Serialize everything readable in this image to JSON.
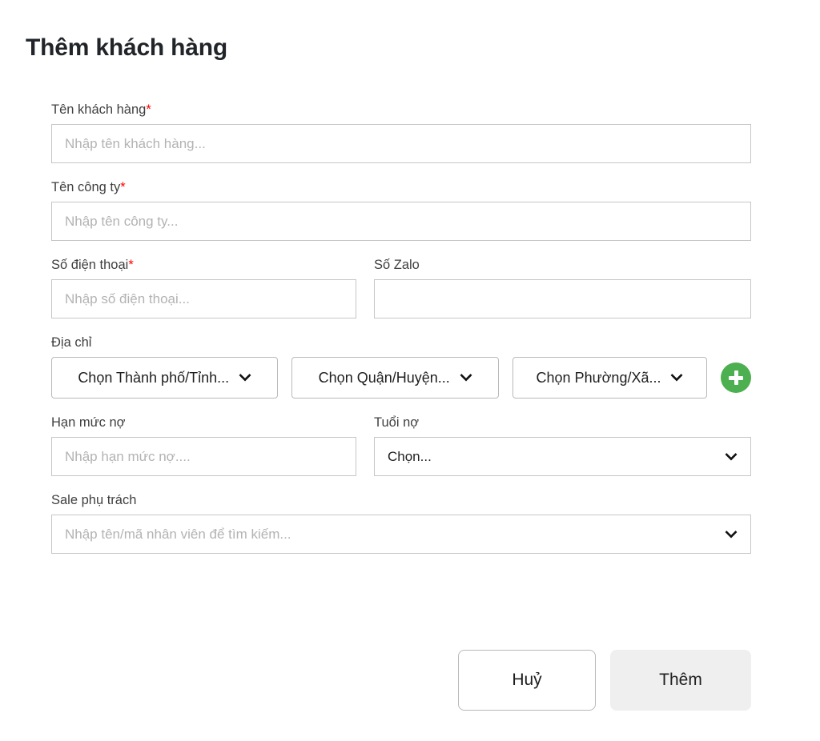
{
  "dialog": {
    "title": "Thêm khách hàng"
  },
  "fields": {
    "customer_name": {
      "label": "Tên khách hàng",
      "required_mark": "*",
      "placeholder": "Nhập tên khách hàng...",
      "value": ""
    },
    "company_name": {
      "label": "Tên công ty",
      "required_mark": "*",
      "placeholder": "Nhập tên công ty...",
      "value": ""
    },
    "phone": {
      "label": "Số điện thoại",
      "required_mark": "*",
      "placeholder": "Nhập số điện thoại...",
      "value": ""
    },
    "zalo": {
      "label": "Số Zalo",
      "placeholder": "",
      "value": ""
    },
    "address": {
      "label": "Địa chỉ",
      "city": {
        "selected": "Chọn Thành phố/Tỉnh..."
      },
      "district": {
        "selected": "Chọn Quận/Huyện..."
      },
      "ward": {
        "selected": "Chọn Phường/Xã..."
      },
      "add_button_icon": "plus-icon"
    },
    "debt_limit": {
      "label": "Hạn mức nợ",
      "placeholder": "Nhập hạn mức nợ....",
      "value": ""
    },
    "debt_age": {
      "label": "Tuổi nợ",
      "selected": "Chọn..."
    },
    "sale_owner": {
      "label": "Sale phụ trách",
      "placeholder": "Nhập tên/mã nhân viên để tìm kiếm...",
      "value": ""
    }
  },
  "footer": {
    "cancel_label": "Huỷ",
    "submit_label": "Thêm"
  },
  "colors": {
    "required_asterisk": "#ff0000",
    "add_button_green": "#4caf50",
    "submit_button_bg": "#efefef",
    "input_border": "#c6c6c6",
    "title_text": "#212529"
  }
}
